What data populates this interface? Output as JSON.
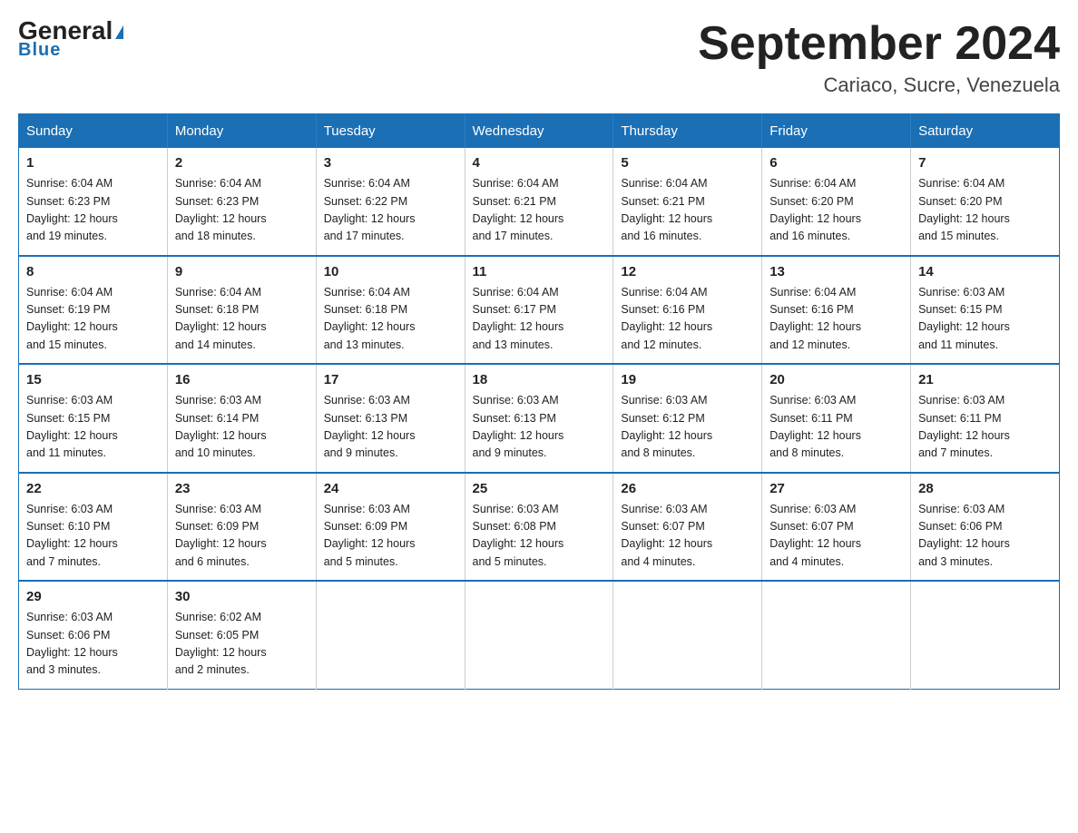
{
  "header": {
    "logo_general": "General",
    "logo_blue": "Blue",
    "main_title": "September 2024",
    "subtitle": "Cariaco, Sucre, Venezuela"
  },
  "days_of_week": [
    "Sunday",
    "Monday",
    "Tuesday",
    "Wednesday",
    "Thursday",
    "Friday",
    "Saturday"
  ],
  "weeks": [
    [
      {
        "day": "1",
        "sunrise": "6:04 AM",
        "sunset": "6:23 PM",
        "daylight": "12 hours and 19 minutes."
      },
      {
        "day": "2",
        "sunrise": "6:04 AM",
        "sunset": "6:23 PM",
        "daylight": "12 hours and 18 minutes."
      },
      {
        "day": "3",
        "sunrise": "6:04 AM",
        "sunset": "6:22 PM",
        "daylight": "12 hours and 17 minutes."
      },
      {
        "day": "4",
        "sunrise": "6:04 AM",
        "sunset": "6:21 PM",
        "daylight": "12 hours and 17 minutes."
      },
      {
        "day": "5",
        "sunrise": "6:04 AM",
        "sunset": "6:21 PM",
        "daylight": "12 hours and 16 minutes."
      },
      {
        "day": "6",
        "sunrise": "6:04 AM",
        "sunset": "6:20 PM",
        "daylight": "12 hours and 16 minutes."
      },
      {
        "day": "7",
        "sunrise": "6:04 AM",
        "sunset": "6:20 PM",
        "daylight": "12 hours and 15 minutes."
      }
    ],
    [
      {
        "day": "8",
        "sunrise": "6:04 AM",
        "sunset": "6:19 PM",
        "daylight": "12 hours and 15 minutes."
      },
      {
        "day": "9",
        "sunrise": "6:04 AM",
        "sunset": "6:18 PM",
        "daylight": "12 hours and 14 minutes."
      },
      {
        "day": "10",
        "sunrise": "6:04 AM",
        "sunset": "6:18 PM",
        "daylight": "12 hours and 13 minutes."
      },
      {
        "day": "11",
        "sunrise": "6:04 AM",
        "sunset": "6:17 PM",
        "daylight": "12 hours and 13 minutes."
      },
      {
        "day": "12",
        "sunrise": "6:04 AM",
        "sunset": "6:16 PM",
        "daylight": "12 hours and 12 minutes."
      },
      {
        "day": "13",
        "sunrise": "6:04 AM",
        "sunset": "6:16 PM",
        "daylight": "12 hours and 12 minutes."
      },
      {
        "day": "14",
        "sunrise": "6:03 AM",
        "sunset": "6:15 PM",
        "daylight": "12 hours and 11 minutes."
      }
    ],
    [
      {
        "day": "15",
        "sunrise": "6:03 AM",
        "sunset": "6:15 PM",
        "daylight": "12 hours and 11 minutes."
      },
      {
        "day": "16",
        "sunrise": "6:03 AM",
        "sunset": "6:14 PM",
        "daylight": "12 hours and 10 minutes."
      },
      {
        "day": "17",
        "sunrise": "6:03 AM",
        "sunset": "6:13 PM",
        "daylight": "12 hours and 9 minutes."
      },
      {
        "day": "18",
        "sunrise": "6:03 AM",
        "sunset": "6:13 PM",
        "daylight": "12 hours and 9 minutes."
      },
      {
        "day": "19",
        "sunrise": "6:03 AM",
        "sunset": "6:12 PM",
        "daylight": "12 hours and 8 minutes."
      },
      {
        "day": "20",
        "sunrise": "6:03 AM",
        "sunset": "6:11 PM",
        "daylight": "12 hours and 8 minutes."
      },
      {
        "day": "21",
        "sunrise": "6:03 AM",
        "sunset": "6:11 PM",
        "daylight": "12 hours and 7 minutes."
      }
    ],
    [
      {
        "day": "22",
        "sunrise": "6:03 AM",
        "sunset": "6:10 PM",
        "daylight": "12 hours and 7 minutes."
      },
      {
        "day": "23",
        "sunrise": "6:03 AM",
        "sunset": "6:09 PM",
        "daylight": "12 hours and 6 minutes."
      },
      {
        "day": "24",
        "sunrise": "6:03 AM",
        "sunset": "6:09 PM",
        "daylight": "12 hours and 5 minutes."
      },
      {
        "day": "25",
        "sunrise": "6:03 AM",
        "sunset": "6:08 PM",
        "daylight": "12 hours and 5 minutes."
      },
      {
        "day": "26",
        "sunrise": "6:03 AM",
        "sunset": "6:07 PM",
        "daylight": "12 hours and 4 minutes."
      },
      {
        "day": "27",
        "sunrise": "6:03 AM",
        "sunset": "6:07 PM",
        "daylight": "12 hours and 4 minutes."
      },
      {
        "day": "28",
        "sunrise": "6:03 AM",
        "sunset": "6:06 PM",
        "daylight": "12 hours and 3 minutes."
      }
    ],
    [
      {
        "day": "29",
        "sunrise": "6:03 AM",
        "sunset": "6:06 PM",
        "daylight": "12 hours and 3 minutes."
      },
      {
        "day": "30",
        "sunrise": "6:02 AM",
        "sunset": "6:05 PM",
        "daylight": "12 hours and 2 minutes."
      },
      null,
      null,
      null,
      null,
      null
    ]
  ],
  "labels": {
    "sunrise": "Sunrise:",
    "sunset": "Sunset:",
    "daylight": "Daylight:"
  }
}
